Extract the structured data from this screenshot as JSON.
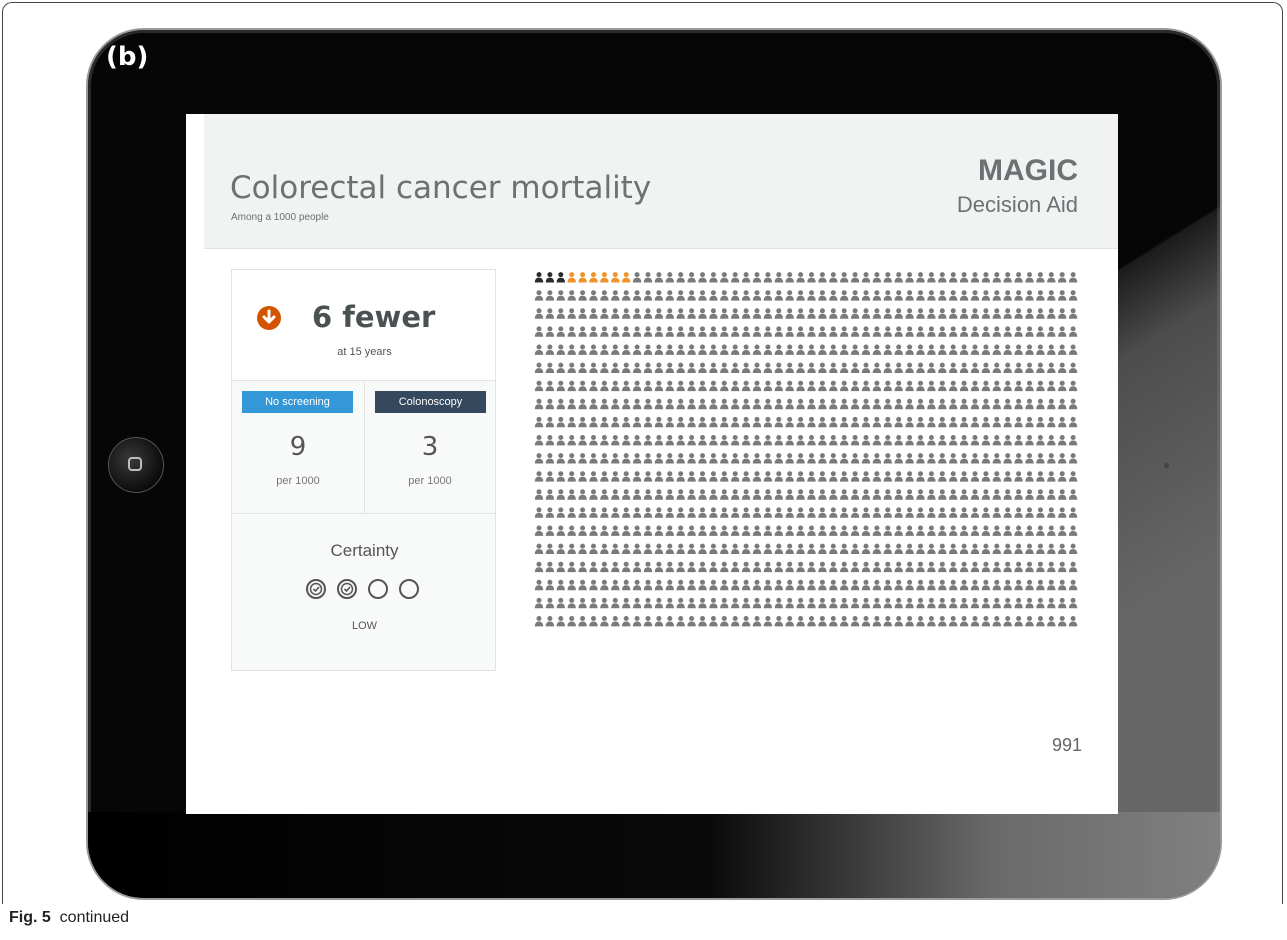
{
  "figure": {
    "panel_label": "(b)",
    "caption_bold": "Fig. 5",
    "caption_text": "continued"
  },
  "screen": {
    "title": "Colorectal cancer mortality",
    "subtitle": "Among a 1000 people",
    "brand": "MAGIC",
    "brand_sub": "Decision Aid"
  },
  "summary": {
    "effect": "6 fewer",
    "effect_sub": "at 15 years",
    "effect_icon": "arrow-down-circle-icon",
    "left": {
      "tag": "No screening",
      "value": "9",
      "unit": "per 1000"
    },
    "right": {
      "tag": "Colonoscopy",
      "value": "3",
      "unit": "per 1000"
    },
    "certainty_label": "Certainty",
    "certainty_level": "LOW",
    "certainty_filled": 2,
    "certainty_total": 4
  },
  "icon_array": {
    "total": 1000,
    "columns": 50,
    "dark": 3,
    "orange": 6,
    "remainder_label": "991"
  },
  "colors": {
    "accent_orange": "#d35400",
    "icon_orange": "#f0932b",
    "icon_dark": "#2b2b2b",
    "icon_gray": "#7a7a7a",
    "tag_blue": "#3497d8",
    "tag_dark": "#34495e"
  }
}
